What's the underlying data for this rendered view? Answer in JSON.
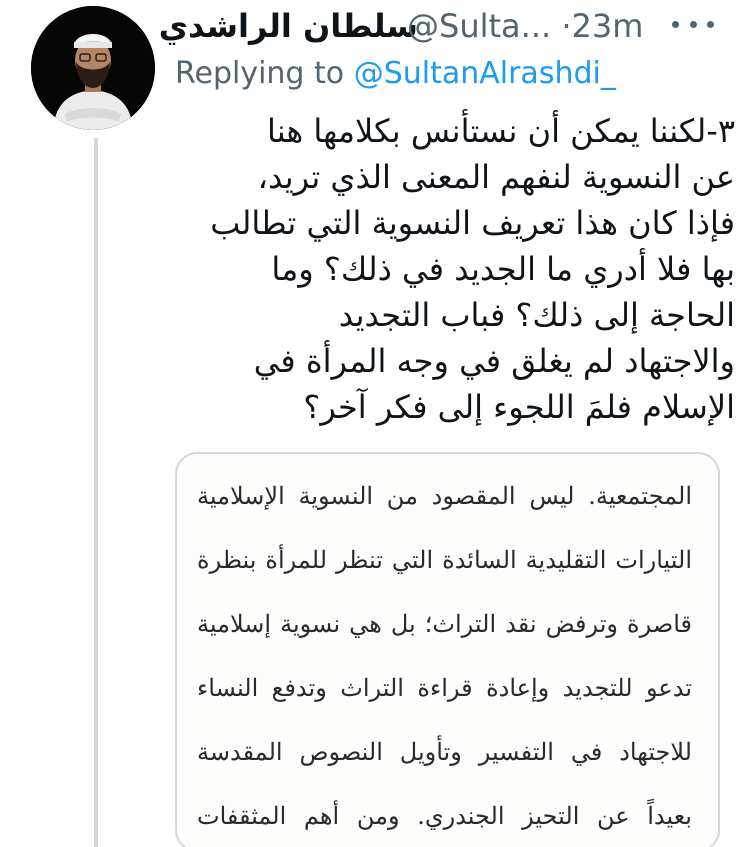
{
  "tweet": {
    "author_name": "سلطان الراشدي",
    "author_handle": "@Sulta...",
    "separator": "·",
    "time": "23m",
    "reply_prefix": "Replying to",
    "reply_mention": "@SultanAlrashdi_",
    "body_lines": [
      "٣-لكننا يمكن أن نستأنس بكلامها هنا",
      "عن النسوية لنفهم المعنى الذي تريد،",
      "فإذا كان هذا تعريف النسوية التي تطالب",
      "بها فلا أدري ما الجديد في ذلك؟ وما",
      "الحاجة إلى ذلك؟ فباب التجديد",
      "والاجتهاد لم يغلق في وجه المرأة في",
      "الإسلام فلمَ اللجوء إلى فكر آخر؟"
    ],
    "media_lines": [
      "المجتمعية. ليس المقصود من النسوية الإسلامية",
      "التيارات التقليدية السائدة التي تنظر للمرأة بنظرة",
      "قاصرة وترفض نقد التراث؛ بل هي نسوية إسلامية",
      "تدعو للتجديد وإعادة قراءة التراث وتدفع النساء",
      "للاجتهاد في التفسير وتأويل النصوص المقدسة",
      "بعيداً عن التحيز الجندري. ومن أهم المثقفات"
    ]
  },
  "icons": {
    "avatar": "avatar-photo",
    "more": "more-options-icon"
  },
  "colors": {
    "text": "#0f1419",
    "secondary": "#536471",
    "accent": "#1d9bf0",
    "border": "#cfd9de"
  }
}
